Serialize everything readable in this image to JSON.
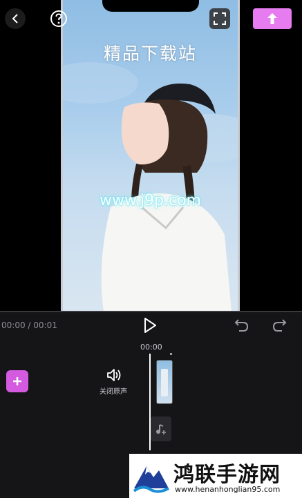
{
  "preview": {
    "watermark_title": "精品下载站",
    "watermark_url": "www.j9p.com"
  },
  "toolbar": {
    "back_icon": "chevron-left-icon",
    "help_icon": "help-circle-icon",
    "fullscreen_icon": "fullscreen-icon",
    "export_icon": "upload-arrow-icon",
    "export_color": "#e77cf0"
  },
  "playback": {
    "time_display": "00:00 / 00:01",
    "ruler_time": "00:00"
  },
  "timeline": {
    "mute_label": "关闭原声",
    "add_color": "#d45be0"
  },
  "banner": {
    "title": "鸿联手游网",
    "url": "www.henanhonglian95.com"
  }
}
